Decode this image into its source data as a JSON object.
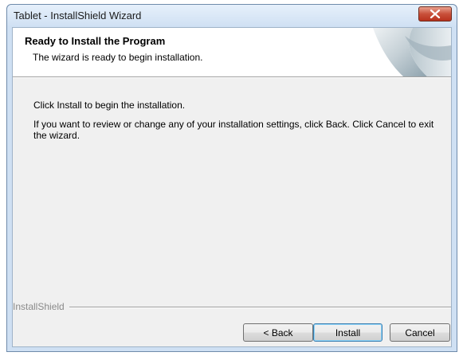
{
  "window": {
    "title": "Tablet - InstallShield Wizard",
    "close_icon": "close-icon"
  },
  "header": {
    "title": "Ready to Install the Program",
    "subtitle": "The wizard is ready to begin installation."
  },
  "body": {
    "line1": "Click Install to begin the installation.",
    "line2": "If you want to review or change any of your installation settings, click Back. Click Cancel to exit the wizard."
  },
  "branding": {
    "label": "InstallShield"
  },
  "buttons": {
    "back": "< Back",
    "install": "Install",
    "cancel": "Cancel"
  },
  "colors": {
    "client_bg": "#f0f0f0",
    "header_bg": "#ffffff",
    "close_red": "#c9503a",
    "default_button_border": "#3c7fb1"
  }
}
